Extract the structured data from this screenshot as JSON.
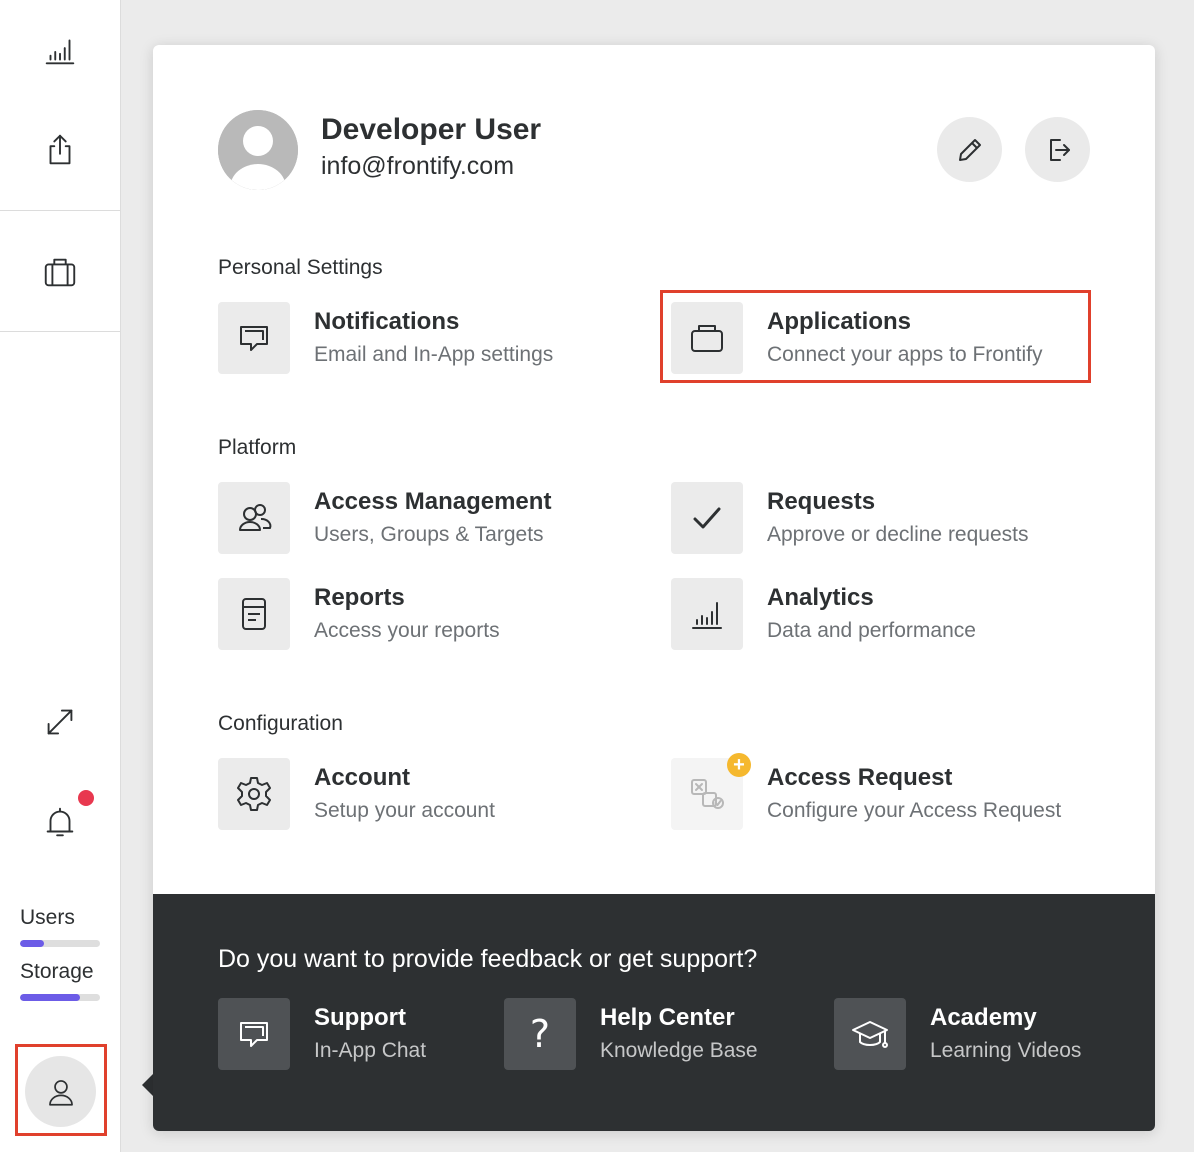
{
  "sidebar": {
    "icons": [
      "analytics-icon",
      "share-icon",
      "briefcase-icon",
      "expand-icon",
      "bell-icon"
    ],
    "notification_dot_color": "#e8384f",
    "quotas": [
      {
        "label": "Users",
        "fill_percent": 30
      },
      {
        "label": "Storage",
        "fill_percent": 75
      }
    ],
    "quota_color": "#6c5ce7"
  },
  "user": {
    "name": "Developer User",
    "email": "info@frontify.com",
    "actions": [
      "edit-icon",
      "logout-icon"
    ]
  },
  "sections": {
    "personal": {
      "title": "Personal Settings",
      "items": [
        {
          "title": "Notifications",
          "subtitle": "Email and In-App settings",
          "icon": "chat-icon"
        },
        {
          "title": "Applications",
          "subtitle": "Connect your apps to Frontify",
          "icon": "briefcase-icon"
        }
      ]
    },
    "platform": {
      "title": "Platform",
      "items": [
        {
          "title": "Access Management",
          "subtitle": "Users, Groups & Targets",
          "icon": "users-icon"
        },
        {
          "title": "Requests",
          "subtitle": "Approve or decline requests",
          "icon": "check-icon"
        },
        {
          "title": "Reports",
          "subtitle": "Access your reports",
          "icon": "document-icon"
        },
        {
          "title": "Analytics",
          "subtitle": "Data and performance",
          "icon": "analytics-icon"
        }
      ]
    },
    "configuration": {
      "title": "Configuration",
      "items": [
        {
          "title": "Account",
          "subtitle": "Setup your account",
          "icon": "gear-icon"
        },
        {
          "title": "Access Request",
          "subtitle": "Configure your Access Request",
          "icon": "access-request-icon",
          "badge": "+"
        }
      ]
    }
  },
  "footer": {
    "title": "Do you want to provide feedback or get support?",
    "items": [
      {
        "title": "Support",
        "subtitle": "In-App Chat",
        "icon": "chat-icon"
      },
      {
        "title": "Help Center",
        "subtitle": "Knowledge Base",
        "icon": "question-icon",
        "glyph": "?"
      },
      {
        "title": "Academy",
        "subtitle": "Learning Videos",
        "icon": "graduation-cap-icon"
      }
    ]
  },
  "colors": {
    "highlight": "#e0402c",
    "footer_bg": "#2d3032",
    "badge": "#f5b82e"
  }
}
